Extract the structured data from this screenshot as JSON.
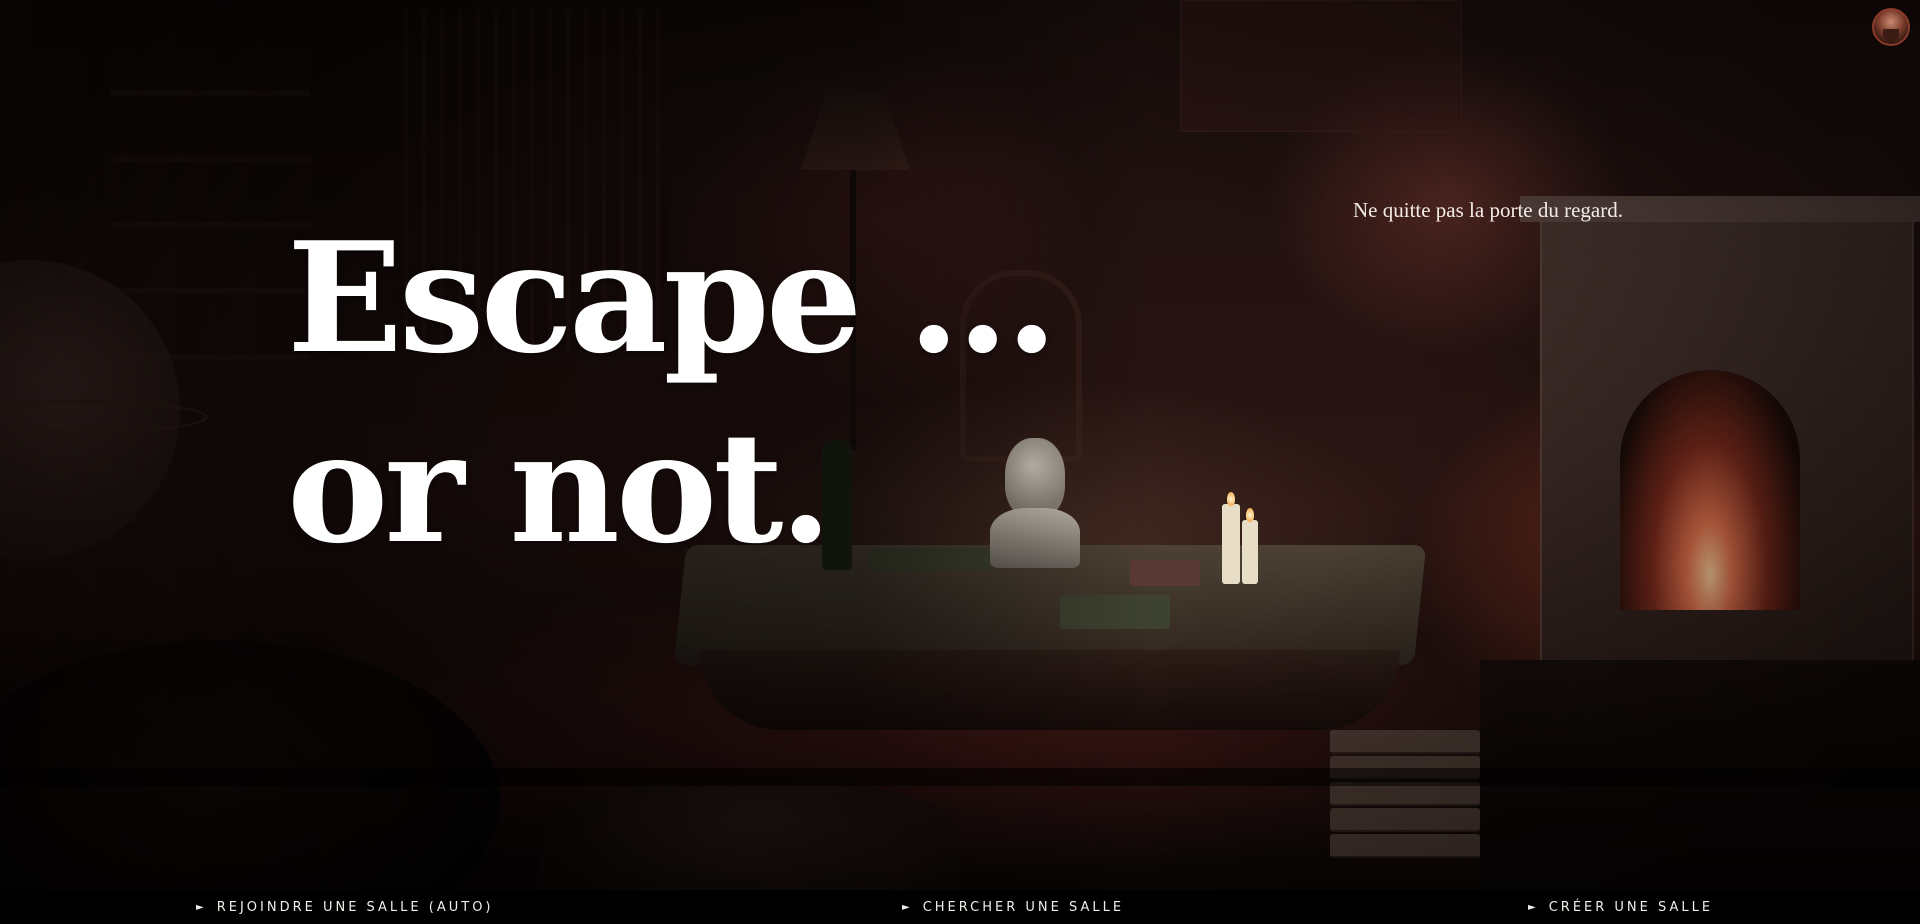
{
  "hero": {
    "title_line1": "Escape ...",
    "title_line2": "or not.",
    "tagline": "Ne quitte pas la porte du regard."
  },
  "nav": {
    "arrow": "►",
    "join_auto": "REJOINDRE UNE SALLE (AUTO)",
    "search": "CHERCHER UNE SALLE",
    "create": "CRÉER UNE SALLE"
  },
  "icons": {
    "avatar": "user-avatar-icon",
    "nav_arrow": "play-triangle-icon"
  },
  "colors": {
    "text": "#ffffff",
    "background": "#0b0706",
    "accent_fire": "#e2714c"
  }
}
